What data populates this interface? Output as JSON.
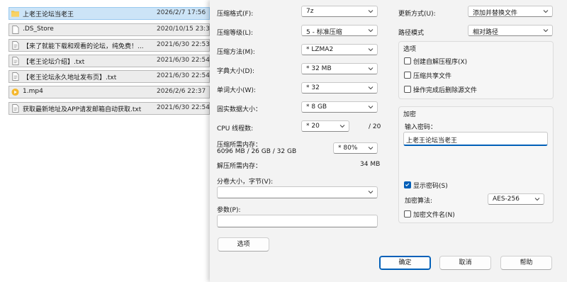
{
  "explorer": {
    "files": [
      {
        "name": "上老王论坛当老王",
        "date": "2026/2/7 17:56",
        "icon": "folder-icon",
        "selected": true
      },
      {
        "name": ".DS_Store",
        "date": "2020/10/15 23:3",
        "icon": "file-icon"
      },
      {
        "name": "【来了就能下载和观看的论坛，纯免费！...",
        "date": "2021/6/30 22:53",
        "icon": "text-file-icon"
      },
      {
        "name": "【老王论坛介绍】.txt",
        "date": "2021/6/30 22:54",
        "icon": "text-file-icon"
      },
      {
        "name": "【老王论坛永久地址发布页】.txt",
        "date": "2021/6/30 22:54",
        "icon": "text-file-icon"
      },
      {
        "name": "1.mp4",
        "date": "2026/2/6 22:37",
        "icon": "video-file-icon"
      },
      {
        "name": "获取最新地址及APP请发邮箱自动获取.txt",
        "date": "2021/6/30 22:54",
        "icon": "text-file-icon"
      }
    ]
  },
  "dialog": {
    "format": {
      "label": "压缩格式(F):",
      "value": "7z"
    },
    "level": {
      "label": "压缩等级(L):",
      "value": "5 - 标准压缩"
    },
    "method": {
      "label": "压缩方法(M):",
      "value": "* LZMA2"
    },
    "dict": {
      "label": "字典大小(D):",
      "value": "* 32 MB"
    },
    "word": {
      "label": "单词大小(W):",
      "value": "* 32"
    },
    "solid": {
      "label": "固实数据大小：",
      "value": "* 8 GB"
    },
    "cpu": {
      "label": "CPU 线程数:",
      "value": "* 20",
      "max": "/ 20"
    },
    "mem_compress": {
      "label": "压缩所需内存：",
      "detail": "6096 MB / 26 GB / 32 GB",
      "value": "* 80%"
    },
    "mem_decompress": {
      "label": "解压所需内存：",
      "value": "34 MB"
    },
    "split": {
      "label": "分卷大小，字节(V):",
      "value": ""
    },
    "params": {
      "label": "参数(P):",
      "value": ""
    },
    "update": {
      "label": "更新方式(U):",
      "value": "添加并替换文件"
    },
    "path": {
      "label": "路径模式",
      "value": "相对路径"
    },
    "options": {
      "title": "选项",
      "sfx": "创建自解压程序(X)",
      "shared": "压缩共享文件",
      "delete": "操作完成后删除源文件"
    },
    "encryption": {
      "title": "加密",
      "pw_label": "输入密码：",
      "password": "上老王论坛当老王",
      "show_pw": "显示密码(S)",
      "method_label": "加密算法:",
      "method": "AES-256",
      "encrypt_names": "加密文件名(N)"
    },
    "buttons": {
      "options": "选项",
      "ok": "确定",
      "cancel": "取消",
      "help": "帮助"
    }
  }
}
